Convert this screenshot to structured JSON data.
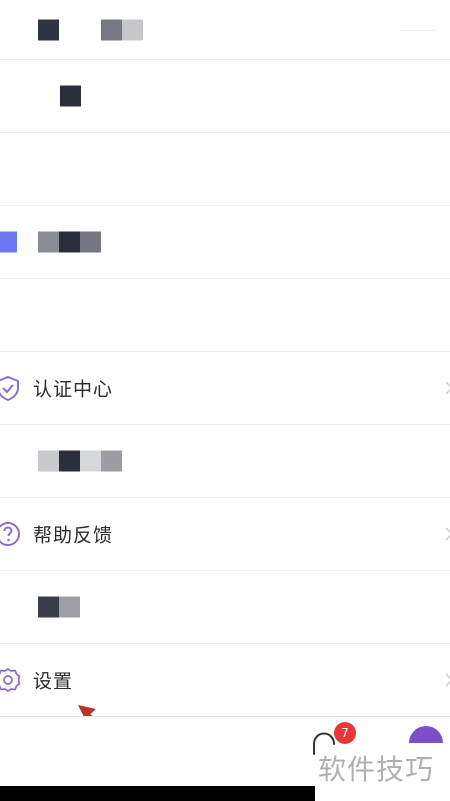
{
  "menu": {
    "items": [
      {
        "label": "认证中心",
        "icon": "shield-check-icon"
      },
      {
        "label": "帮助反馈",
        "icon": "question-circle-icon"
      },
      {
        "label": "设置",
        "icon": "gear-icon"
      }
    ]
  },
  "tabbar": {
    "messages_badge": "7"
  },
  "watermark": {
    "text": "软件技巧"
  },
  "colors": {
    "accent_blue": "#6b76f0",
    "badge_red": "#e8363a",
    "arrow_red": "#b8342e",
    "icon_purple": "#8a70c9"
  }
}
